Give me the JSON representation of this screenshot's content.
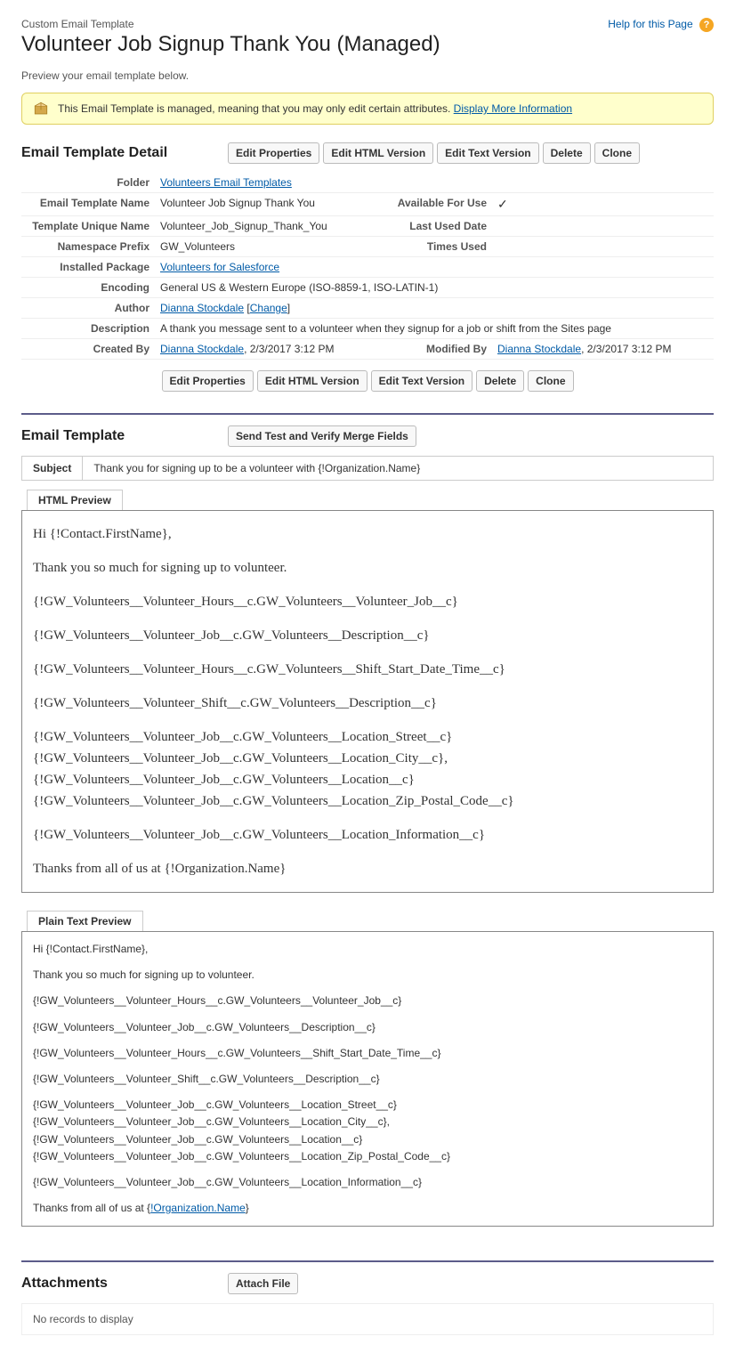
{
  "header": {
    "breadcrumb": "Custom Email Template",
    "title": "Volunteer Job Signup Thank You (Managed)",
    "help_text": "Help for this Page",
    "preview_text": "Preview your email template below."
  },
  "info_box": {
    "message": "This Email Template is managed, meaning that you may only edit certain attributes. ",
    "link": "Display More Information"
  },
  "detail": {
    "section_title": "Email Template Detail",
    "buttons": {
      "edit_properties": "Edit Properties",
      "edit_html": "Edit HTML Version",
      "edit_text": "Edit Text Version",
      "delete": "Delete",
      "clone": "Clone"
    },
    "fields": {
      "folder_label": "Folder",
      "folder_value": "Volunteers Email Templates",
      "name_label": "Email Template Name",
      "name_value": "Volunteer Job Signup Thank You",
      "available_label": "Available For Use",
      "unique_label": "Template Unique Name",
      "unique_value": "Volunteer_Job_Signup_Thank_You",
      "last_used_label": "Last Used Date",
      "last_used_value": "",
      "namespace_label": "Namespace Prefix",
      "namespace_value": "GW_Volunteers",
      "times_used_label": "Times Used",
      "times_used_value": "",
      "package_label": "Installed Package",
      "package_value": "Volunteers for Salesforce",
      "encoding_label": "Encoding",
      "encoding_value": "General US & Western Europe (ISO-8859-1, ISO-LATIN-1)",
      "author_label": "Author",
      "author_value": "Dianna Stockdale",
      "author_change": "Change",
      "description_label": "Description",
      "description_value": "A thank you message sent to a volunteer when they signup for a job or shift from the Sites page",
      "created_by_label": "Created By",
      "created_by_name": "Dianna Stockdale",
      "created_by_date": ", 2/3/2017 3:12 PM",
      "modified_by_label": "Modified By",
      "modified_by_name": "Dianna Stockdale",
      "modified_by_date": ", 2/3/2017 3:12 PM"
    }
  },
  "template": {
    "section_title": "Email Template",
    "send_test_button": "Send Test and Verify Merge Fields",
    "subject_label": "Subject",
    "subject_value": "Thank you for signing up to be a volunteer with {!Organization.Name}",
    "html_tab": "HTML Preview",
    "plain_tab": "Plain Text Preview",
    "html_body": {
      "p1": "Hi {!Contact.FirstName},",
      "p2": "Thank you so much for signing up to volunteer.",
      "p3": "{!GW_Volunteers__Volunteer_Hours__c.GW_Volunteers__Volunteer_Job__c}",
      "p4": "{!GW_Volunteers__Volunteer_Job__c.GW_Volunteers__Description__c}",
      "p5": "{!GW_Volunteers__Volunteer_Hours__c.GW_Volunteers__Shift_Start_Date_Time__c}",
      "p6": "{!GW_Volunteers__Volunteer_Shift__c.GW_Volunteers__Description__c}",
      "p7a": "{!GW_Volunteers__Volunteer_Job__c.GW_Volunteers__Location_Street__c}",
      "p7b": "{!GW_Volunteers__Volunteer_Job__c.GW_Volunteers__Location_City__c},",
      "p7c": "{!GW_Volunteers__Volunteer_Job__c.GW_Volunteers__Location__c}",
      "p7d": "{!GW_Volunteers__Volunteer_Job__c.GW_Volunteers__Location_Zip_Postal_Code__c}",
      "p8": "{!GW_Volunteers__Volunteer_Job__c.GW_Volunteers__Location_Information__c}",
      "p9": "Thanks from all of us at {!Organization.Name}"
    },
    "plain_body": {
      "p1": "Hi {!Contact.FirstName},",
      "p2": "Thank you so much for signing up to volunteer.",
      "p3": "{!GW_Volunteers__Volunteer_Hours__c.GW_Volunteers__Volunteer_Job__c}",
      "p4": "{!GW_Volunteers__Volunteer_Job__c.GW_Volunteers__Description__c}",
      "p5": "{!GW_Volunteers__Volunteer_Hours__c.GW_Volunteers__Shift_Start_Date_Time__c}",
      "p6": "{!GW_Volunteers__Volunteer_Shift__c.GW_Volunteers__Description__c}",
      "p7a": "{!GW_Volunteers__Volunteer_Job__c.GW_Volunteers__Location_Street__c}",
      "p7b": "{!GW_Volunteers__Volunteer_Job__c.GW_Volunteers__Location_City__c},",
      "p7c": "{!GW_Volunteers__Volunteer_Job__c.GW_Volunteers__Location__c}",
      "p7d": "{!GW_Volunteers__Volunteer_Job__c.GW_Volunteers__Location_Zip_Postal_Code__c}",
      "p8": "{!GW_Volunteers__Volunteer_Job__c.GW_Volunteers__Location_Information__c}",
      "p9a": "Thanks from all of us at {",
      "p9b": "!Organization.Name",
      "p9c": "}"
    }
  },
  "attachments": {
    "section_title": "Attachments",
    "attach_button": "Attach File",
    "no_records": "No records to display"
  }
}
